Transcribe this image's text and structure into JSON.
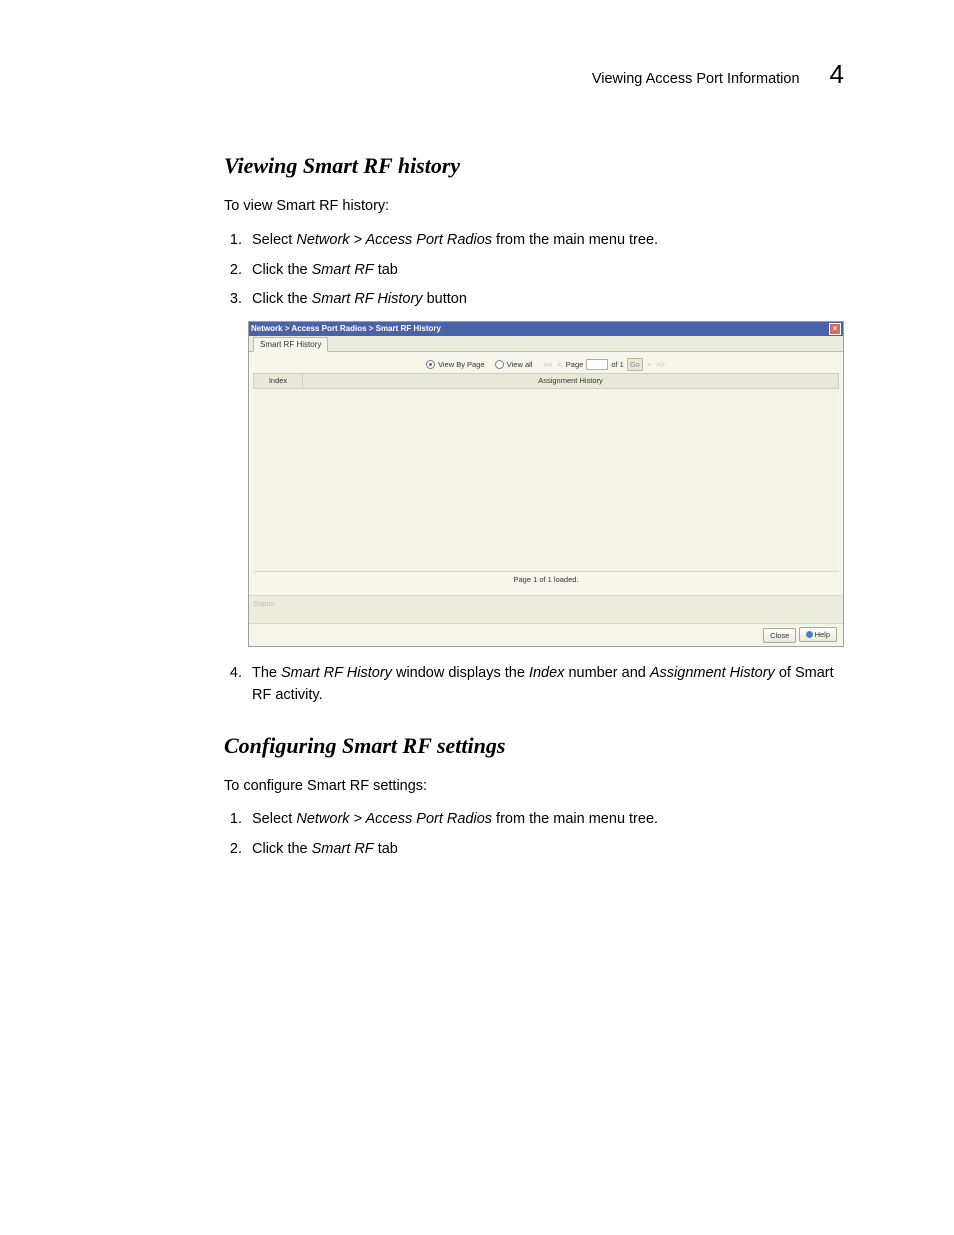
{
  "header": {
    "title": "Viewing Access Port Information",
    "chapter": "4"
  },
  "section1": {
    "heading": "Viewing Smart RF history",
    "lead": "To view Smart RF history:",
    "step1_a": "Select ",
    "step1_b": "Network > Access Port Radios",
    "step1_c": " from the main menu tree.",
    "step2_a": "Click the ",
    "step2_b": "Smart RF",
    "step2_c": " tab",
    "step3_a": "Click the ",
    "step3_b": "Smart RF History",
    "step3_c": " button",
    "step4_a": "The ",
    "step4_b": "Smart RF History",
    "step4_c": " window displays the ",
    "step4_d": "Index",
    "step4_e": " number and ",
    "step4_f": "Assignment History",
    "step4_g": " of Smart RF activity."
  },
  "embed": {
    "breadcrumb": "Network > Access Port Radios > Smart RF History",
    "tab_label": "Smart RF History",
    "view_by_page": "View By Page",
    "view_all": "View all",
    "page_input": "",
    "page_label_a": "Page",
    "page_label_b": "of 1",
    "go": "Go",
    "col_index": "Index",
    "col_history": "Assignment History",
    "page_status": "Page 1 of 1 loaded.",
    "status_label": "Status:",
    "btn_close": "Close",
    "btn_help": "Help"
  },
  "section2": {
    "heading": "Configuring Smart RF settings",
    "lead": "To configure Smart RF settings:",
    "step1_a": "Select ",
    "step1_b": "Network > Access Port Radios",
    "step1_c": " from the main menu tree.",
    "step2_a": "Click the ",
    "step2_b": "Smart RF",
    "step2_c": " tab"
  }
}
